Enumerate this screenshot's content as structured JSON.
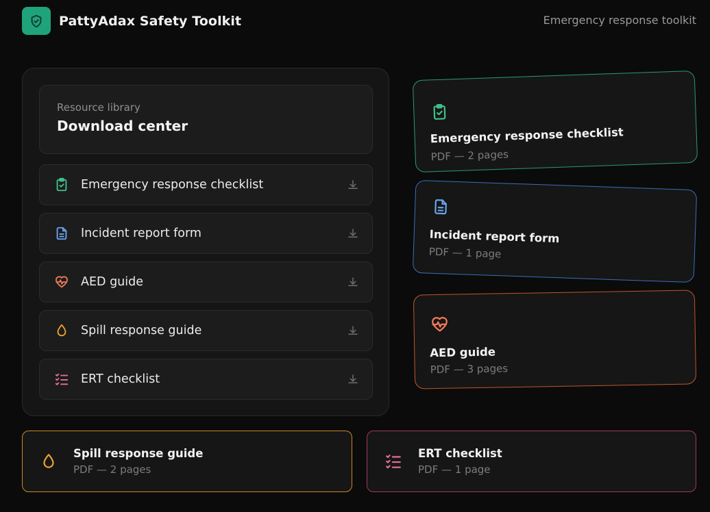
{
  "header": {
    "brand_title": "PattyAdax Safety Toolkit",
    "tagline": "Emergency response toolkit",
    "brand_icon": "shield-icon",
    "brand_color": "#1fa37a"
  },
  "library": {
    "kicker": "Resource library",
    "title": "Download center",
    "items": [
      {
        "label": "Emergency response checklist",
        "icon": "clipboard-check-icon",
        "color": "#3fc38f"
      },
      {
        "label": "Incident report form",
        "icon": "document-icon",
        "color": "#6aa4ee"
      },
      {
        "label": "AED guide",
        "icon": "heart-pulse-icon",
        "color": "#ef7a58"
      },
      {
        "label": "Spill response guide",
        "icon": "droplet-icon",
        "color": "#f0a22e"
      },
      {
        "label": "ERT checklist",
        "icon": "list-check-icon",
        "color": "#e6709a"
      }
    ],
    "download_icon": "download-icon"
  },
  "cards": [
    {
      "title": "Emergency response checklist",
      "meta": "PDF — 2 pages",
      "color": "#2c9a73"
    },
    {
      "title": "Incident report form",
      "meta": "PDF — 1 page",
      "color": "#3b6fb8"
    },
    {
      "title": "AED guide",
      "meta": "PDF — 3 pages",
      "color": "#c0562e"
    },
    {
      "title": "Spill response guide",
      "meta": "PDF — 2 pages",
      "color": "#c98a22"
    },
    {
      "title": "ERT checklist",
      "meta": "PDF — 1 page",
      "color": "#a0395f"
    }
  ]
}
